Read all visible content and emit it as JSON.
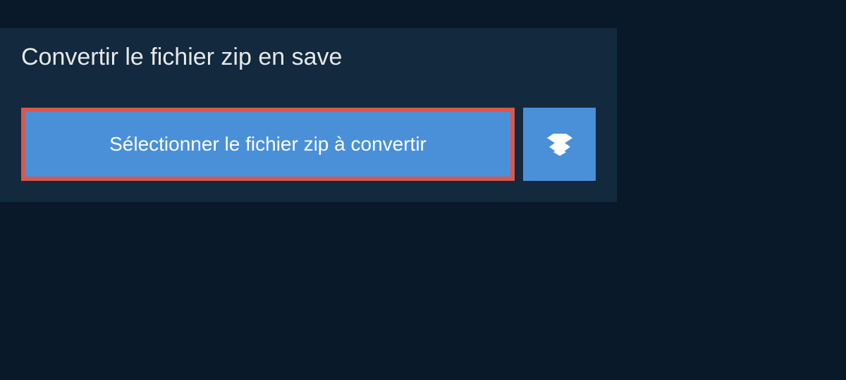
{
  "header": {
    "title": "Convertir le fichier zip en save"
  },
  "actions": {
    "select_file_label": "Sélectionner le fichier zip à convertir",
    "dropbox_icon_name": "dropbox"
  },
  "colors": {
    "background_dark": "#0a1929",
    "panel_dark": "#12293e",
    "button_blue": "#4a90d9",
    "highlight_red": "#d9584d",
    "text_light": "#e8e8e8",
    "text_white": "#ffffff"
  }
}
